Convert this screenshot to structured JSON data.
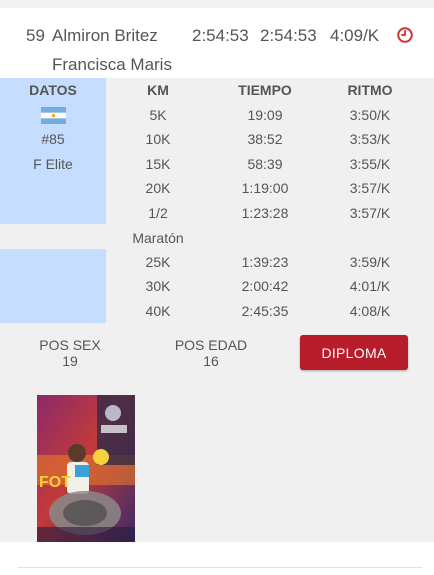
{
  "summary": {
    "position": "59",
    "name_line1": "Almiron Britez",
    "name_line2": "Francisca Maris",
    "time_official": "2:54:53",
    "time_net": "2:54:53",
    "pace": "4:09/K",
    "clock_icon": "clock-icon",
    "accent_color": "#d32f2f"
  },
  "athlete": {
    "header": "DATOS",
    "flag": "argentina-flag",
    "bib": "#85",
    "category": "F Elite"
  },
  "splits": {
    "headers": {
      "km": "KM",
      "time": "TIEMPO",
      "pace": "RITMO"
    },
    "rows": [
      {
        "km": "5K",
        "time": "19:09",
        "pace": "3:50/K"
      },
      {
        "km": "10K",
        "time": "38:52",
        "pace": "3:53/K"
      },
      {
        "km": "15K",
        "time": "58:39",
        "pace": "3:55/K"
      },
      {
        "km": "20K",
        "time": "1:19:00",
        "pace": "3:57/K"
      },
      {
        "km": "1/2",
        "time": "1:23:28",
        "pace": "3:57/K"
      },
      {
        "km": "Maratón",
        "time": "",
        "pace": ""
      },
      {
        "km": "25K",
        "time": "1:39:23",
        "pace": "3:59/K"
      },
      {
        "km": "30K",
        "time": "2:00:42",
        "pace": "4:01/K"
      },
      {
        "km": "40K",
        "time": "2:45:35",
        "pace": "4:08/K"
      }
    ]
  },
  "positions": {
    "sex_label": "POS SEX",
    "sex_value": "19",
    "age_label": "POS EDAD",
    "age_value": "16"
  },
  "diploma_button": {
    "label": "DIPLOMA",
    "color": "#b71c2b"
  },
  "photo": {
    "name": "finish-photo"
  }
}
